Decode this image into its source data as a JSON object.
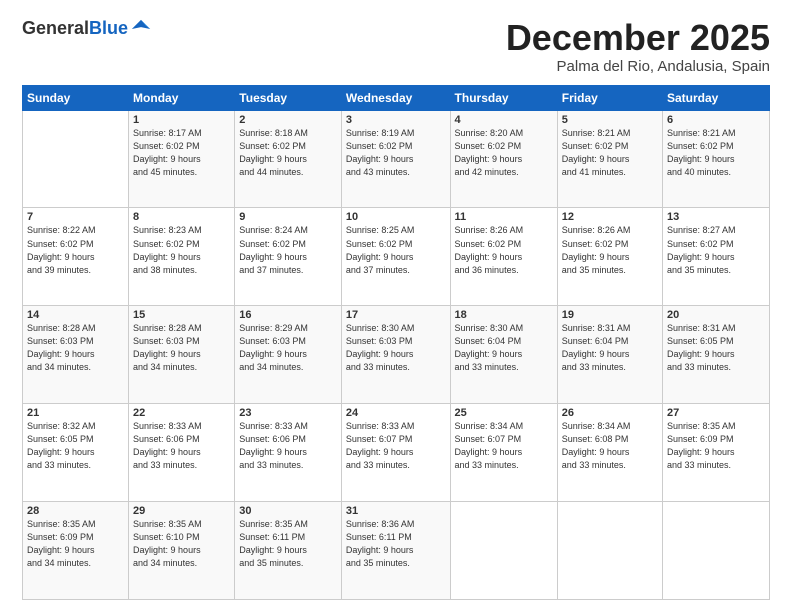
{
  "logo": {
    "general": "General",
    "blue": "Blue"
  },
  "header": {
    "title": "December 2025",
    "subtitle": "Palma del Rio, Andalusia, Spain"
  },
  "weekdays": [
    "Sunday",
    "Monday",
    "Tuesday",
    "Wednesday",
    "Thursday",
    "Friday",
    "Saturday"
  ],
  "weeks": [
    [
      {
        "day": "",
        "sunrise": "",
        "sunset": "",
        "daylight": ""
      },
      {
        "day": "1",
        "sunrise": "Sunrise: 8:17 AM",
        "sunset": "Sunset: 6:02 PM",
        "daylight": "Daylight: 9 hours and 45 minutes."
      },
      {
        "day": "2",
        "sunrise": "Sunrise: 8:18 AM",
        "sunset": "Sunset: 6:02 PM",
        "daylight": "Daylight: 9 hours and 44 minutes."
      },
      {
        "day": "3",
        "sunrise": "Sunrise: 8:19 AM",
        "sunset": "Sunset: 6:02 PM",
        "daylight": "Daylight: 9 hours and 43 minutes."
      },
      {
        "day": "4",
        "sunrise": "Sunrise: 8:20 AM",
        "sunset": "Sunset: 6:02 PM",
        "daylight": "Daylight: 9 hours and 42 minutes."
      },
      {
        "day": "5",
        "sunrise": "Sunrise: 8:21 AM",
        "sunset": "Sunset: 6:02 PM",
        "daylight": "Daylight: 9 hours and 41 minutes."
      },
      {
        "day": "6",
        "sunrise": "Sunrise: 8:21 AM",
        "sunset": "Sunset: 6:02 PM",
        "daylight": "Daylight: 9 hours and 40 minutes."
      }
    ],
    [
      {
        "day": "7",
        "sunrise": "Sunrise: 8:22 AM",
        "sunset": "Sunset: 6:02 PM",
        "daylight": "Daylight: 9 hours and 39 minutes."
      },
      {
        "day": "8",
        "sunrise": "Sunrise: 8:23 AM",
        "sunset": "Sunset: 6:02 PM",
        "daylight": "Daylight: 9 hours and 38 minutes."
      },
      {
        "day": "9",
        "sunrise": "Sunrise: 8:24 AM",
        "sunset": "Sunset: 6:02 PM",
        "daylight": "Daylight: 9 hours and 37 minutes."
      },
      {
        "day": "10",
        "sunrise": "Sunrise: 8:25 AM",
        "sunset": "Sunset: 6:02 PM",
        "daylight": "Daylight: 9 hours and 37 minutes."
      },
      {
        "day": "11",
        "sunrise": "Sunrise: 8:26 AM",
        "sunset": "Sunset: 6:02 PM",
        "daylight": "Daylight: 9 hours and 36 minutes."
      },
      {
        "day": "12",
        "sunrise": "Sunrise: 8:26 AM",
        "sunset": "Sunset: 6:02 PM",
        "daylight": "Daylight: 9 hours and 35 minutes."
      },
      {
        "day": "13",
        "sunrise": "Sunrise: 8:27 AM",
        "sunset": "Sunset: 6:02 PM",
        "daylight": "Daylight: 9 hours and 35 minutes."
      }
    ],
    [
      {
        "day": "14",
        "sunrise": "Sunrise: 8:28 AM",
        "sunset": "Sunset: 6:03 PM",
        "daylight": "Daylight: 9 hours and 34 minutes."
      },
      {
        "day": "15",
        "sunrise": "Sunrise: 8:28 AM",
        "sunset": "Sunset: 6:03 PM",
        "daylight": "Daylight: 9 hours and 34 minutes."
      },
      {
        "day": "16",
        "sunrise": "Sunrise: 8:29 AM",
        "sunset": "Sunset: 6:03 PM",
        "daylight": "Daylight: 9 hours and 34 minutes."
      },
      {
        "day": "17",
        "sunrise": "Sunrise: 8:30 AM",
        "sunset": "Sunset: 6:03 PM",
        "daylight": "Daylight: 9 hours and 33 minutes."
      },
      {
        "day": "18",
        "sunrise": "Sunrise: 8:30 AM",
        "sunset": "Sunset: 6:04 PM",
        "daylight": "Daylight: 9 hours and 33 minutes."
      },
      {
        "day": "19",
        "sunrise": "Sunrise: 8:31 AM",
        "sunset": "Sunset: 6:04 PM",
        "daylight": "Daylight: 9 hours and 33 minutes."
      },
      {
        "day": "20",
        "sunrise": "Sunrise: 8:31 AM",
        "sunset": "Sunset: 6:05 PM",
        "daylight": "Daylight: 9 hours and 33 minutes."
      }
    ],
    [
      {
        "day": "21",
        "sunrise": "Sunrise: 8:32 AM",
        "sunset": "Sunset: 6:05 PM",
        "daylight": "Daylight: 9 hours and 33 minutes."
      },
      {
        "day": "22",
        "sunrise": "Sunrise: 8:33 AM",
        "sunset": "Sunset: 6:06 PM",
        "daylight": "Daylight: 9 hours and 33 minutes."
      },
      {
        "day": "23",
        "sunrise": "Sunrise: 8:33 AM",
        "sunset": "Sunset: 6:06 PM",
        "daylight": "Daylight: 9 hours and 33 minutes."
      },
      {
        "day": "24",
        "sunrise": "Sunrise: 8:33 AM",
        "sunset": "Sunset: 6:07 PM",
        "daylight": "Daylight: 9 hours and 33 minutes."
      },
      {
        "day": "25",
        "sunrise": "Sunrise: 8:34 AM",
        "sunset": "Sunset: 6:07 PM",
        "daylight": "Daylight: 9 hours and 33 minutes."
      },
      {
        "day": "26",
        "sunrise": "Sunrise: 8:34 AM",
        "sunset": "Sunset: 6:08 PM",
        "daylight": "Daylight: 9 hours and 33 minutes."
      },
      {
        "day": "27",
        "sunrise": "Sunrise: 8:35 AM",
        "sunset": "Sunset: 6:09 PM",
        "daylight": "Daylight: 9 hours and 33 minutes."
      }
    ],
    [
      {
        "day": "28",
        "sunrise": "Sunrise: 8:35 AM",
        "sunset": "Sunset: 6:09 PM",
        "daylight": "Daylight: 9 hours and 34 minutes."
      },
      {
        "day": "29",
        "sunrise": "Sunrise: 8:35 AM",
        "sunset": "Sunset: 6:10 PM",
        "daylight": "Daylight: 9 hours and 34 minutes."
      },
      {
        "day": "30",
        "sunrise": "Sunrise: 8:35 AM",
        "sunset": "Sunset: 6:11 PM",
        "daylight": "Daylight: 9 hours and 35 minutes."
      },
      {
        "day": "31",
        "sunrise": "Sunrise: 8:36 AM",
        "sunset": "Sunset: 6:11 PM",
        "daylight": "Daylight: 9 hours and 35 minutes."
      },
      {
        "day": "",
        "sunrise": "",
        "sunset": "",
        "daylight": ""
      },
      {
        "day": "",
        "sunrise": "",
        "sunset": "",
        "daylight": ""
      },
      {
        "day": "",
        "sunrise": "",
        "sunset": "",
        "daylight": ""
      }
    ]
  ]
}
